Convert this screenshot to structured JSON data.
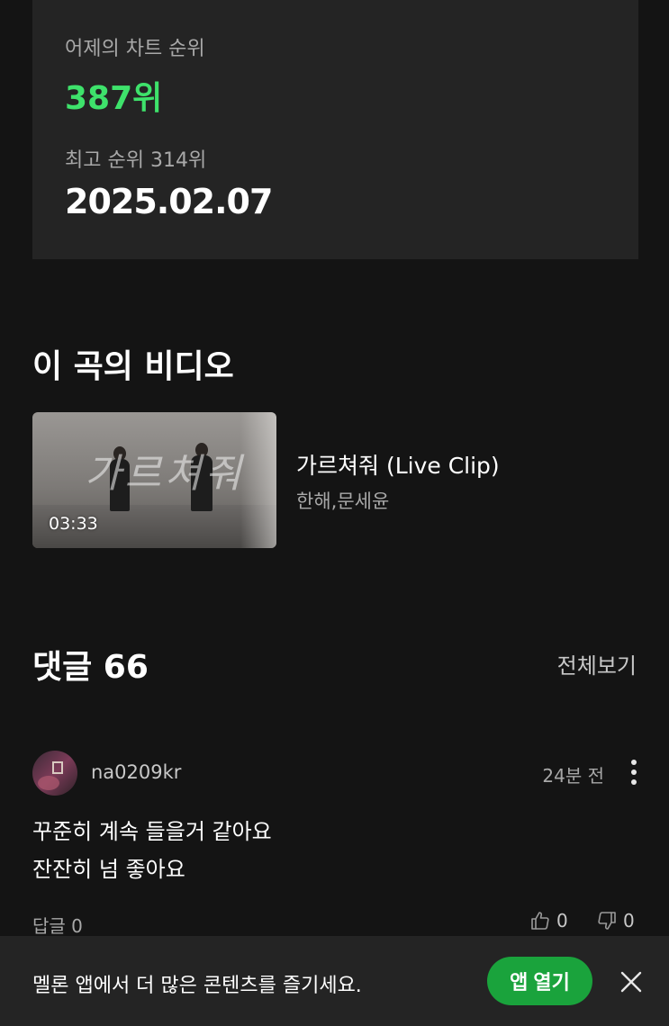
{
  "chart_rank": {
    "yesterday_label": "어제의 차트 순위",
    "yesterday_value": "387위",
    "best_label": "최고 순위 314위",
    "best_date": "2025.02.07",
    "accent_color": "#3ee26b"
  },
  "videos": {
    "title": "이 곡의 비디오",
    "items": [
      {
        "title": "가르쳐줘 (Live Clip)",
        "artist": "한해,문세윤",
        "duration": "03:33",
        "thumbnail_script": "가르쳐줘"
      }
    ]
  },
  "comments": {
    "title": "댓글 66",
    "view_all_label": "전체보기",
    "items": [
      {
        "username": "na0209kr",
        "time": "24분 전",
        "lines": [
          "꾸준히 계속 들을거 같아요",
          "잔잔히 넘 좋아요"
        ],
        "reply_label": "답글 0",
        "likes": "0",
        "dislikes": "0"
      }
    ]
  },
  "banner": {
    "text": "멜론 앱에서 더 많은 콘텐츠를 즐기세요.",
    "open_app_label": "앱 열기",
    "button_color": "#1aa33c"
  },
  "icons": {
    "more": "more-vertical-icon",
    "like": "thumbs-up-icon",
    "dislike": "thumbs-down-icon",
    "close": "close-icon"
  }
}
